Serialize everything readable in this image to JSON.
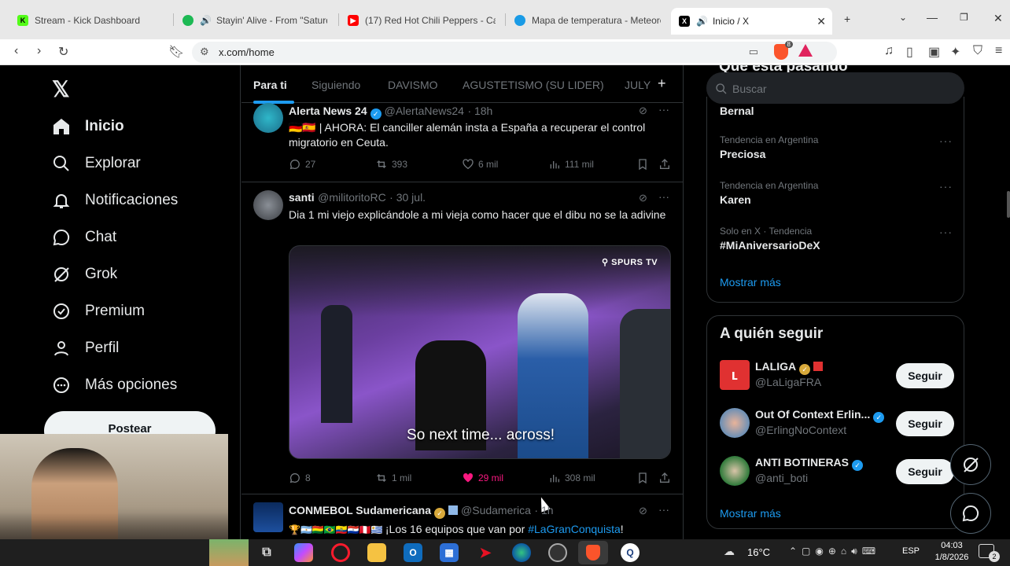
{
  "browser": {
    "tabs": [
      {
        "title": "Stream - Kick Dashboard",
        "favicon_color": "#53fc18",
        "favicon": "K"
      },
      {
        "title": "Stayin' Alive - From \"Saturday",
        "favicon_color": "#1db954",
        "favicon": "♪"
      },
      {
        "title": "(17) Red Hot Chili Peppers - Cali",
        "favicon_color": "#ff0000",
        "favicon": "▶"
      },
      {
        "title": "Mapa de temperatura - Meteore",
        "favicon_color": "#1a9be6",
        "favicon": "◉"
      },
      {
        "title": "Inicio / X",
        "favicon_color": "#000000",
        "favicon": "X"
      }
    ],
    "url": "x.com/home",
    "brave_badge": "8"
  },
  "sidebar": {
    "items": [
      {
        "label": "Inicio",
        "icon": "home-icon"
      },
      {
        "label": "Explorar",
        "icon": "search-icon"
      },
      {
        "label": "Notificaciones",
        "icon": "bell-icon"
      },
      {
        "label": "Chat",
        "icon": "chat-icon"
      },
      {
        "label": "Grok",
        "icon": "grok-icon"
      },
      {
        "label": "Premium",
        "icon": "premium-icon"
      },
      {
        "label": "Perfil",
        "icon": "user-icon"
      },
      {
        "label": "Más opciones",
        "icon": "more-icon"
      }
    ],
    "post_label": "Postear"
  },
  "feed": {
    "tabs": [
      "Para ti",
      "Siguiendo",
      "DAVISMO",
      "AGUSTETISMO (SU LIDER)",
      "JULY"
    ],
    "tweets": [
      {
        "name": "Alerta News 24",
        "handle": "@AlertaNews24",
        "time": "· 18h",
        "flags": "🇩🇪🇪🇸",
        "text": "| AHORA: El canciller alemán insta a España a recuperar el control migratorio en Ceuta.",
        "replies": "27",
        "reposts": "393",
        "likes": "6 mil",
        "views": "111 mil"
      },
      {
        "name": "santi",
        "handle": "@militoritoRC",
        "time": "· 30 jul.",
        "text": "Dia 1 mi viejo explicándole a mi vieja como hacer que el dibu no se la adivine",
        "media_caption": "So next time... across!",
        "media_watermark": "SPURS TV",
        "replies": "8",
        "reposts": "1 mil",
        "likes": "29 mil",
        "views": "308 mil"
      },
      {
        "name": "CONMEBOL Sudamericana",
        "handle": "@Sudamerica",
        "time": "· 1h",
        "text_prefix": "¡Los 16 equipos que van por ",
        "hashtag": "#LaGranConquista",
        "text_suffix": "!"
      }
    ]
  },
  "right": {
    "header_partial": "Qué está pasando",
    "search_placeholder": "Buscar",
    "trends": [
      {
        "meta": "",
        "name": "Bernal"
      },
      {
        "meta": "Tendencia en Argentina",
        "name": "Preciosa"
      },
      {
        "meta": "Tendencia en Argentina",
        "name": "Karen"
      },
      {
        "meta": "Solo en X · Tendencia",
        "name": "#MiAniversarioDeX"
      }
    ],
    "show_more": "Mostrar más",
    "who_to_follow_title": "A quién seguir",
    "follow": [
      {
        "name": "LALIGA",
        "handle": "@LaLigaFRA",
        "avatar_color": "#e03131",
        "badge": "gold"
      },
      {
        "name": "Out Of Context Erlin...",
        "handle": "@ErlingNoContext",
        "avatar_color": "#6b8fb5",
        "badge": "blue"
      },
      {
        "name": "ANTI BOTINERAS",
        "handle": "@anti_boti",
        "avatar_color": "#2f7a3a",
        "badge": "blue"
      }
    ],
    "follow_label": "Seguir",
    "show_more_2": "Mostrar más"
  },
  "taskbar": {
    "weather": "16°C",
    "lang": "ESP",
    "time": "04:03",
    "date": "1/8/2026",
    "notif_count": "2"
  }
}
